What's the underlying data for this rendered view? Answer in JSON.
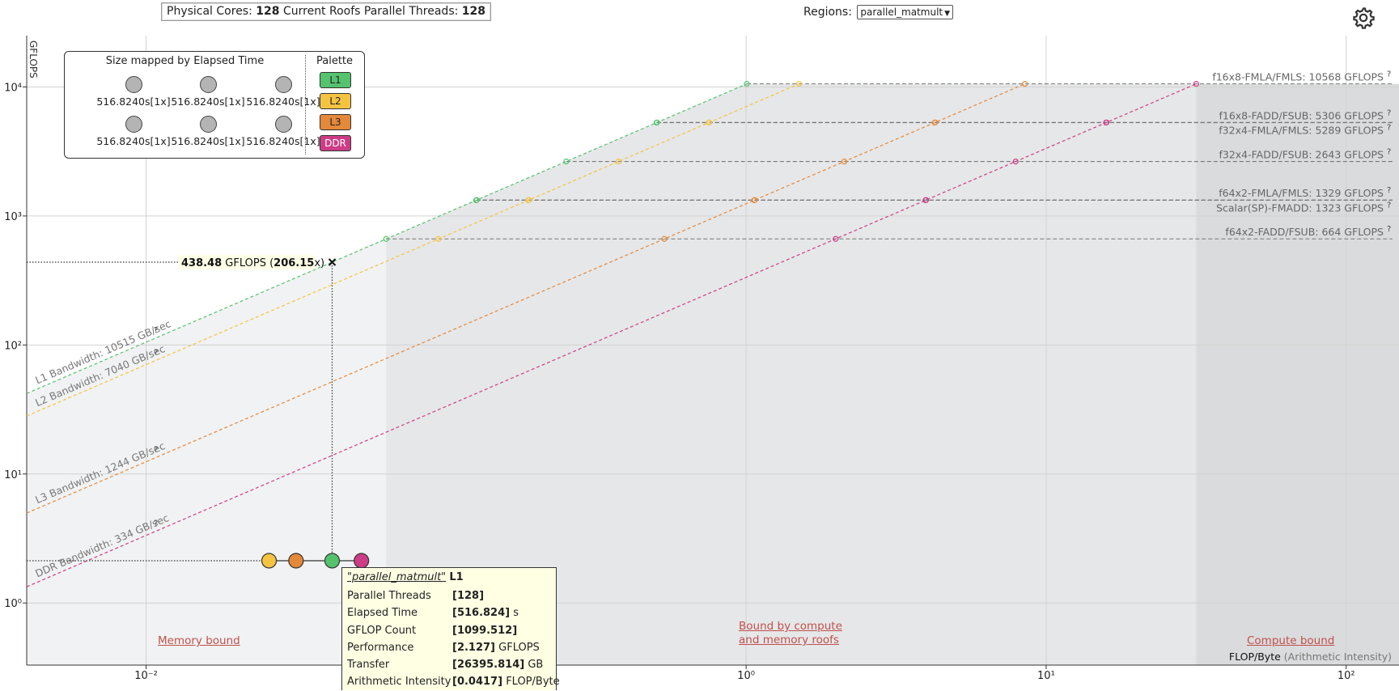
{
  "header": {
    "cores_label": "Physical Cores:",
    "cores_value": "128",
    "threads_label": "Current Roofs Parallel Threads:",
    "threads_value": "128"
  },
  "regions": {
    "label": "Regions:",
    "selected": "parallel_matmult"
  },
  "settings_icon": "gear-icon",
  "legend": {
    "size_title": "Size mapped by Elapsed Time",
    "size_items": [
      "516.8240s[1x]",
      "516.8240s[1x]",
      "516.8240s[1x]",
      "516.8240s[1x]",
      "516.8240s[1x]",
      "516.8240s[1x]"
    ],
    "palette_title": "Palette",
    "palette": [
      {
        "label": "L1",
        "color": "#55c26e"
      },
      {
        "label": "L2",
        "color": "#f5c342"
      },
      {
        "label": "L3",
        "color": "#e4883a"
      },
      {
        "label": "DDR",
        "color": "#cc3d86"
      }
    ]
  },
  "zones": {
    "memory": "Memory bound",
    "both_line1": "Bound by compute",
    "both_line2": "and memory roofs",
    "compute": "Compute bound"
  },
  "tooltip": {
    "region": "\"parallel_matmult\"",
    "level": "L1",
    "rows": [
      {
        "key": "Parallel Threads",
        "value": "[128]",
        "unit": ""
      },
      {
        "key": "Elapsed Time",
        "value": "[516.824]",
        "unit": " s"
      },
      {
        "key": "GFLOP Count",
        "value": "[1099.512]",
        "unit": ""
      },
      {
        "key": "Performance",
        "value": "[2.127]",
        "unit": " GFLOPS"
      },
      {
        "key": "Transfer",
        "value": "[26395.814]",
        "unit": " GB"
      },
      {
        "key": "Arithmetic Intensity",
        "value": "[0.0417]",
        "unit": " FLOP/Byte"
      }
    ]
  },
  "chart_data": {
    "type": "scatter",
    "scale": "log-log",
    "ylabel": "GFLOPS",
    "xlabel": "FLOP/Byte",
    "xlabel_note": "(Arithmetic Intensity)",
    "xlim": [
      0.004,
      150
    ],
    "ylim": [
      0.33,
      25000
    ],
    "x_ticks": [
      {
        "label": "10⁻²",
        "value": 0.01
      },
      {
        "label": "10⁰",
        "value": 1
      },
      {
        "label": "10¹",
        "value": 10
      },
      {
        "label": "10²",
        "value": 100
      }
    ],
    "y_ticks": [
      {
        "label": "10⁰",
        "value": 1
      },
      {
        "label": "10¹",
        "value": 10
      },
      {
        "label": "10²",
        "value": 100
      },
      {
        "label": "10³",
        "value": 1000
      },
      {
        "label": "10⁴",
        "value": 10000
      }
    ],
    "memory_roofs": [
      {
        "name": "L1 Bandwidth: 10515 GB/sec",
        "bandwidth": 10515,
        "color": "#55c26e"
      },
      {
        "name": "L2 Bandwidth: 7040 GB/sec",
        "bandwidth": 7040,
        "color": "#f5c342"
      },
      {
        "name": "L3 Bandwidth: 1244 GB/sec",
        "bandwidth": 1244,
        "color": "#e4883a"
      },
      {
        "name": "DDR Bandwidth: 334 GB/sec",
        "bandwidth": 334,
        "color": "#cc3d86"
      }
    ],
    "compute_roofs": [
      {
        "name": "f16x8-FMLA/FMLS: 10568 GFLOPS",
        "gflops": 10568
      },
      {
        "name": "f16x8-FADD/FSUB: 5306 GFLOPS",
        "gflops": 5306
      },
      {
        "name": "f32x4-FMLA/FMLS: 5289 GFLOPS",
        "gflops": 5289
      },
      {
        "name": "f32x4-FADD/FSUB: 2643 GFLOPS",
        "gflops": 2643
      },
      {
        "name": "f64x2-FMLA/FMLS: 1329 GFLOPS",
        "gflops": 1329
      },
      {
        "name": "Scalar(SP)-FMADD: 1323 GFLOPS",
        "gflops": 1323
      },
      {
        "name": "f64x2-FADD/FSUB: 664 GFLOPS",
        "gflops": 664
      }
    ],
    "points": [
      {
        "level": "L2",
        "x": 0.0257,
        "y": 2.127,
        "color": "#f5c342"
      },
      {
        "level": "L3",
        "x": 0.0316,
        "y": 2.127,
        "color": "#e4883a"
      },
      {
        "level": "L1",
        "x": 0.0417,
        "y": 2.127,
        "color": "#55c26e"
      },
      {
        "level": "DDR",
        "x": 0.0522,
        "y": 2.127,
        "color": "#cc3d86"
      }
    ],
    "marker": {
      "x": 0.0417,
      "y": 438.48,
      "value_label": "438.48",
      "unit": "GFLOPS",
      "ratio_label": "206.15",
      "ratio_suffix": "x"
    }
  }
}
